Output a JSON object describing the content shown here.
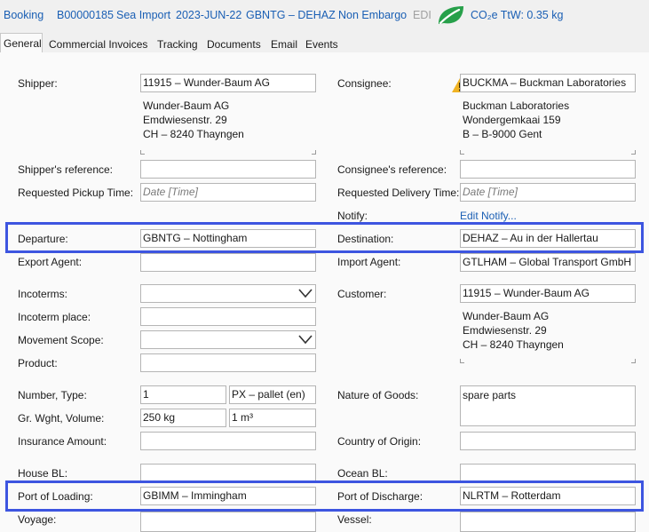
{
  "header": {
    "type": "Booking",
    "number": "B00000185",
    "direction": "Sea Import",
    "date": "2023-JUN-22",
    "route": "GBNTG – DEHAZ",
    "embargo": "Non Embargo",
    "edi": "EDI",
    "co2": "CO₂e TtW: 0.35 kg"
  },
  "tabs": [
    "General",
    "Commercial Invoices",
    "Tracking",
    "Documents",
    "Email",
    "Events"
  ],
  "form": {
    "shipper": {
      "label": "Shipper:",
      "value": "11915 – Wunder-Baum AG",
      "address": "Wunder-Baum AG\nEmdwiesenstr. 29\nCH – 8240 Thayngen"
    },
    "consignee": {
      "label": "Consignee:",
      "value": "BUCKMA – Buckman Laboratories",
      "address": "Buckman Laboratories\nWondergemkaai 159\nB – B-9000 Gent"
    },
    "shipper_ref": {
      "label": "Shipper's reference:",
      "value": ""
    },
    "consignee_ref": {
      "label": "Consignee's reference:",
      "value": ""
    },
    "pickup_time": {
      "label": "Requested Pickup Time:",
      "placeholder": "Date [Time]"
    },
    "delivery_time": {
      "label": "Requested Delivery Time:",
      "placeholder": "Date [Time]"
    },
    "notify": {
      "label": "Notify:",
      "link": "Edit Notify..."
    },
    "departure": {
      "label": "Departure:",
      "value": "GBNTG – Nottingham"
    },
    "destination": {
      "label": "Destination:",
      "value": "DEHAZ – Au in der Hallertau"
    },
    "export_agent": {
      "label": "Export Agent:",
      "value": ""
    },
    "import_agent": {
      "label": "Import Agent:",
      "value": "GTLHAM – Global Transport GmbH H"
    },
    "incoterms": {
      "label": "Incoterms:",
      "value": ""
    },
    "customer": {
      "label": "Customer:",
      "value": "11915 – Wunder-Baum AG",
      "address": "Wunder-Baum AG\nEmdwiesenstr. 29\nCH – 8240 Thayngen"
    },
    "incoterm_place": {
      "label": "Incoterm place:",
      "value": ""
    },
    "movement_scope": {
      "label": "Movement Scope:",
      "value": ""
    },
    "product": {
      "label": "Product:",
      "value": ""
    },
    "number_type": {
      "label": "Number, Type:",
      "number": "1",
      "type": "PX – pallet (en)"
    },
    "nature_of_goods": {
      "label": "Nature of Goods:",
      "value": "spare parts"
    },
    "weight_volume": {
      "label": "Gr. Wght, Volume:",
      "weight": "250 kg",
      "volume": "1 m³"
    },
    "insurance": {
      "label": "Insurance Amount:",
      "value": ""
    },
    "country_origin": {
      "label": "Country of Origin:",
      "value": ""
    },
    "house_bl": {
      "label": "House BL:",
      "value": ""
    },
    "ocean_bl": {
      "label": "Ocean BL:",
      "value": ""
    },
    "port_loading": {
      "label": "Port of Loading:",
      "value": "GBIMM – Immingham"
    },
    "port_discharge": {
      "label": "Port of Discharge:",
      "value": "NLRTM – Rotterdam"
    },
    "voyage": {
      "label": "Voyage:",
      "value": ""
    },
    "vessel": {
      "label": "Vessel:",
      "value": ""
    }
  },
  "colors": {
    "highlight": "#3d55e0",
    "link": "#1a5fb4",
    "leaf": "#27a04a",
    "warning": "#f0b323"
  }
}
